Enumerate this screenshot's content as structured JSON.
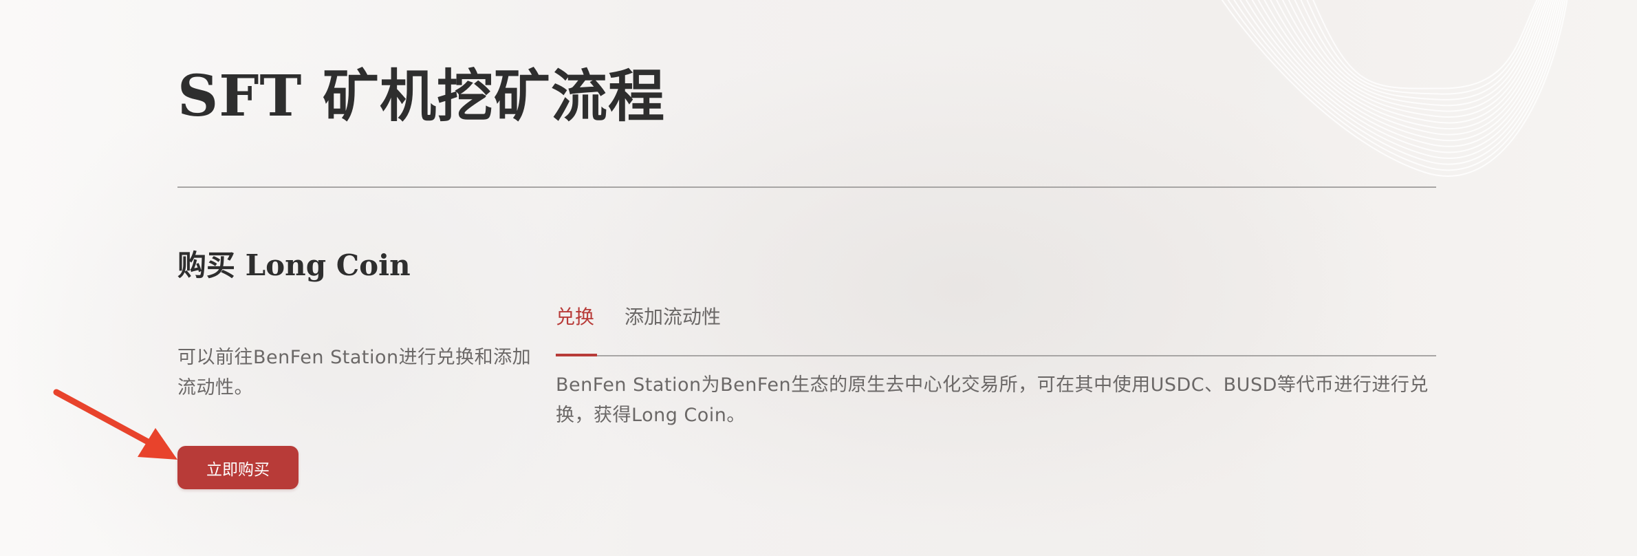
{
  "page": {
    "title": "SFT 矿机挖矿流程"
  },
  "section": {
    "title": "购买 Long Coin",
    "description": "可以前往BenFen Station进行兑换和添加流动性。",
    "buy_button_label": "立即购买"
  },
  "tabs": [
    {
      "label": "兑换",
      "active": true
    },
    {
      "label": "添加流动性",
      "active": false
    }
  ],
  "tab_content": {
    "text": "BenFen Station为BenFen生态的原生去中心化交易所，可在其中使用USDC、BUSD等代币进行进行兑换，获得Long Coin。"
  },
  "colors": {
    "accent": "#b83b38",
    "arrow": "#e8432c",
    "heading": "#2e2e2e",
    "body_text": "#6b6867"
  },
  "icons": {
    "annotation": "arrow-pointer-icon",
    "background": "wave-lines-decoration"
  }
}
